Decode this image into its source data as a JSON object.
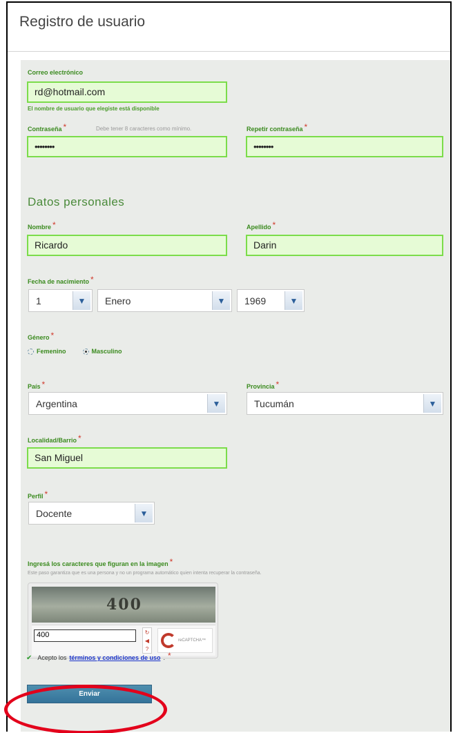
{
  "page": {
    "title": "Registro de usuario"
  },
  "account": {
    "email_label": "Correo electrónico",
    "email_value": "rd@hotmail.com",
    "email_status": "El nombre de usuario que elegiste está disponible",
    "password_label": "Contraseña",
    "password_hint": "Debe tener 8 caracteres como mínimo.",
    "password_value": "••••••••",
    "repeat_label": "Repetir contraseña",
    "repeat_value": "••••••••"
  },
  "personal": {
    "section_title": "Datos personales",
    "first_name_label": "Nombre",
    "first_name_value": "Ricardo",
    "last_name_label": "Apellido",
    "last_name_value": "Darin",
    "birth_label": "Fecha de nacimiento",
    "birth_day": "1",
    "birth_month": "Enero",
    "birth_year": "1969",
    "gender_label": "Género",
    "gender_options": [
      "Femenino",
      "Masculino"
    ],
    "gender_selected": "Masculino",
    "country_label": "País",
    "country_value": "Argentina",
    "province_label": "Provincia",
    "province_value": "Tucumán",
    "locality_label": "Localidad/Barrio",
    "locality_value": "San Miguel",
    "profile_label": "Perfil",
    "profile_value": "Docente"
  },
  "captcha": {
    "label": "Ingresá los caracteres que figuran en la imagen",
    "hint": "Este paso garantiza que es una persona y no un programa automático quien intenta recuperar la contraseña.",
    "image_text": "400",
    "input_value": "400",
    "logo_text": "reCAPTCHA™"
  },
  "terms": {
    "prefix": "Acepto los",
    "link": "términos y condiciones de uso",
    "suffix": "."
  },
  "submit_label": "Enviar",
  "colors": {
    "field_border": "#7bdc4a",
    "field_bg": "#e6fbd6",
    "label": "#3a8a1e",
    "required": "#d0392b",
    "button": "#3a7aa0",
    "highlight": "#e3001b"
  }
}
